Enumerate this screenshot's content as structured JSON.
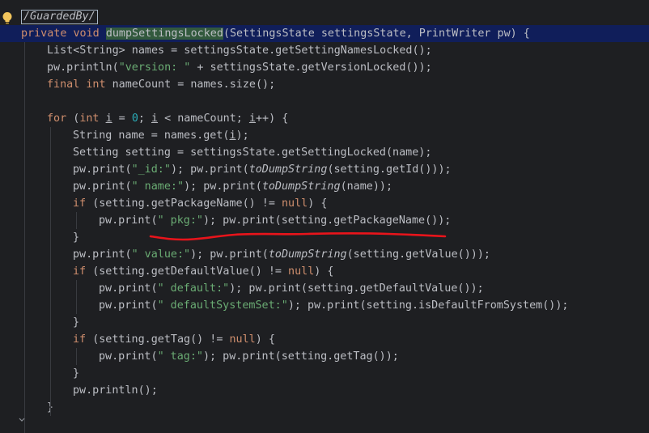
{
  "editor": {
    "lines": [
      {
        "indent": 0,
        "tokens": [
          {
            "t": "/GuardedBy/",
            "c": "annot"
          }
        ]
      },
      {
        "indent": 0,
        "caret": true,
        "tokens": [
          {
            "t": "private void ",
            "c": "kw"
          },
          {
            "t": "dumpSettingsLocked",
            "c": "hl-method"
          },
          {
            "t": "(SettingsState settingsState, PrintWriter pw) {"
          }
        ]
      },
      {
        "indent": 1,
        "tokens": [
          {
            "t": "List<String> names = settingsState.getSettingNamesLocked();"
          }
        ]
      },
      {
        "indent": 1,
        "tokens": [
          {
            "t": "pw.println("
          },
          {
            "t": "\"version: \"",
            "c": "str"
          },
          {
            "t": " + settingsState.getVersionLocked());"
          }
        ]
      },
      {
        "indent": 1,
        "tokens": [
          {
            "t": "final int ",
            "c": "kw"
          },
          {
            "t": "nameCount = names.size();"
          }
        ]
      },
      {
        "indent": 0,
        "tokens": []
      },
      {
        "indent": 1,
        "tokens": [
          {
            "t": "for ",
            "c": "kw"
          },
          {
            "t": "("
          },
          {
            "t": "int ",
            "c": "kw"
          },
          {
            "t": "i",
            "c": "ul"
          },
          {
            "t": " = "
          },
          {
            "t": "0",
            "c": "num"
          },
          {
            "t": "; "
          },
          {
            "t": "i",
            "c": "ul"
          },
          {
            "t": " < nameCount; "
          },
          {
            "t": "i",
            "c": "ul"
          },
          {
            "t": "++) {"
          }
        ]
      },
      {
        "indent": 2,
        "tokens": [
          {
            "t": "String name = names.get("
          },
          {
            "t": "i",
            "c": "ul"
          },
          {
            "t": ");"
          }
        ]
      },
      {
        "indent": 2,
        "tokens": [
          {
            "t": "Setting setting = settingsState.getSettingLocked(name);"
          }
        ]
      },
      {
        "indent": 2,
        "tokens": [
          {
            "t": "pw.print("
          },
          {
            "t": "\"_id:\"",
            "c": "str"
          },
          {
            "t": "); pw.print("
          },
          {
            "t": "toDumpString",
            "c": "it"
          },
          {
            "t": "(setting.getId()));"
          }
        ]
      },
      {
        "indent": 2,
        "tokens": [
          {
            "t": "pw.print("
          },
          {
            "t": "\" name:\"",
            "c": "str"
          },
          {
            "t": "); pw.print("
          },
          {
            "t": "toDumpString",
            "c": "it"
          },
          {
            "t": "(name));"
          }
        ]
      },
      {
        "indent": 2,
        "tokens": [
          {
            "t": "if ",
            "c": "kw"
          },
          {
            "t": "(setting.getPackageName() != "
          },
          {
            "t": "null",
            "c": "kw"
          },
          {
            "t": ") {"
          }
        ]
      },
      {
        "indent": 3,
        "tokens": [
          {
            "t": "pw.print("
          },
          {
            "t": "\" pkg:\"",
            "c": "str"
          },
          {
            "t": "); pw.print(setting.getPackageName());"
          }
        ]
      },
      {
        "indent": 2,
        "tokens": [
          {
            "t": "}"
          }
        ]
      },
      {
        "indent": 2,
        "tokens": [
          {
            "t": "pw.print("
          },
          {
            "t": "\" value:\"",
            "c": "str"
          },
          {
            "t": "); pw.print("
          },
          {
            "t": "toDumpString",
            "c": "it"
          },
          {
            "t": "(setting.getValue()));"
          }
        ]
      },
      {
        "indent": 2,
        "tokens": [
          {
            "t": "if ",
            "c": "kw"
          },
          {
            "t": "(setting.getDefaultValue() != "
          },
          {
            "t": "null",
            "c": "kw"
          },
          {
            "t": ") {"
          }
        ]
      },
      {
        "indent": 3,
        "tokens": [
          {
            "t": "pw.print("
          },
          {
            "t": "\" default:\"",
            "c": "str"
          },
          {
            "t": "); pw.print(setting.getDefaultValue());"
          }
        ]
      },
      {
        "indent": 3,
        "tokens": [
          {
            "t": "pw.print("
          },
          {
            "t": "\" defaultSystemSet:\"",
            "c": "str"
          },
          {
            "t": "); pw.print(setting.isDefaultFromSystem());"
          }
        ]
      },
      {
        "indent": 2,
        "tokens": [
          {
            "t": "}"
          }
        ]
      },
      {
        "indent": 2,
        "tokens": [
          {
            "t": "if ",
            "c": "kw"
          },
          {
            "t": "(setting.getTag() != "
          },
          {
            "t": "null",
            "c": "kw"
          },
          {
            "t": ") {"
          }
        ]
      },
      {
        "indent": 3,
        "tokens": [
          {
            "t": "pw.print("
          },
          {
            "t": "\" tag:\"",
            "c": "str"
          },
          {
            "t": "); pw.print(setting.getTag());"
          }
        ]
      },
      {
        "indent": 2,
        "tokens": [
          {
            "t": "}"
          }
        ]
      },
      {
        "indent": 2,
        "tokens": [
          {
            "t": "pw.println();"
          }
        ]
      },
      {
        "indent": 1,
        "tokens": [
          {
            "t": "}"
          }
        ]
      }
    ]
  },
  "gutter": {
    "bulb_icon": "lightbulb-icon",
    "bulb_color": "#f2c55c"
  },
  "annotation": {
    "underline_color": "#e8141b"
  }
}
